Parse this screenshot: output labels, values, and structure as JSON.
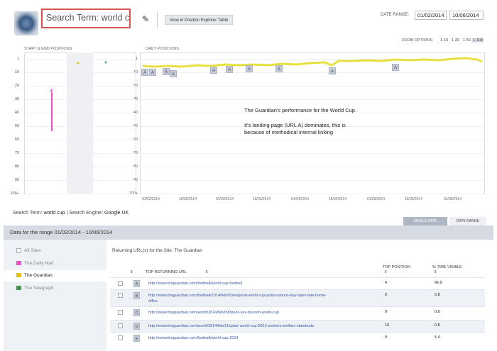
{
  "header": {
    "search_term": "Search Term: world cup",
    "view_button": "View in Position Explorer Table",
    "date_range_label": "DATE RANGE:",
    "date_start": "01/02/2014",
    "date_end": "10/06/2014",
    "edit_icon": "✎",
    "logo_icon": "logo-icon"
  },
  "zoom": {
    "label": "ZOOM OPTIONS:",
    "options": [
      "1-10",
      "1-20",
      "1-50",
      "1-100"
    ],
    "selected": "1-100"
  },
  "charts": {
    "start_end_title": "START & END POSITIONS",
    "daily_title": "DAILY POSITIONS",
    "y_ticks": [
      "1",
      "10",
      "20",
      "30",
      "40",
      "50",
      "60",
      "70",
      "80",
      "90",
      "100+"
    ],
    "x_ticks": [
      "01/02/2014",
      "15/02/2014",
      "01/03/2014",
      "15/03/2014",
      "01/04/2014",
      "15/04/2014",
      "01/05/2014",
      "15/05/2014",
      "01/06/2014"
    ],
    "start_marker": "▲",
    "end_marker": "▼",
    "annotation": {
      "line1": "The Guardian's performance for the World Cup.",
      "line2": "It's landing page (URL A) dominates, this is",
      "line3": "because of methodical internal linking"
    },
    "flags": [
      "A",
      "A",
      "A",
      "A",
      "A",
      "A",
      "A",
      "A",
      "A",
      "A"
    ],
    "colors": {
      "line": "#e8e040",
      "pink": "#ee4fcf",
      "start": "#e0c20d",
      "end": "#3d9a4a"
    }
  },
  "info": {
    "search_term_label": "Search Term:",
    "search_term_value": "world cup",
    "separator": "|",
    "engine_label": "Search Engine:",
    "engine_value": "Google UK",
    "single_date": "SINGLE DATE",
    "date_range": "DATE RANGE",
    "range_text": "Data for the range 01/02/2014 - 10/06/2014"
  },
  "sites": {
    "all": "All Sites",
    "items": [
      {
        "name": "The Daily Mail",
        "color": "#ee4fcf"
      },
      {
        "name": "The Guardian",
        "color": "#e0c20d"
      },
      {
        "name": "The Telegraph",
        "color": "#3d9a4a"
      }
    ]
  },
  "table": {
    "returning_label": "Returning URL(s) for the Site: The Guardian",
    "sort_icon": "⇕",
    "headers": {
      "url": "TOP RETURNING URL",
      "position": "TOP POSITION",
      "visible": "% TIME VISIBLE"
    },
    "rows": [
      {
        "letter": "A",
        "url": "http://www.theguardian.com/football/world-cup-football",
        "url2": "",
        "position": "4",
        "visible": "96.9"
      },
      {
        "letter": "B",
        "url": "http://www.theguardian.com/football/2014/feb/02/england-world-cup-pubs-cannot-stay-open-late-home-",
        "url2": "office",
        "position": "9",
        "visible": "0.8"
      },
      {
        "letter": "C",
        "url": "http://www.theguardian.com/world/2014/feb/09/brazil-sex-tourism-world-cup",
        "url2": "",
        "position": "9",
        "visible": "0.8"
      },
      {
        "letter": "D",
        "url": "http://www.theguardian.com/world/2014/feb/11/qatar-world-cup-2022-workers-welfare-standards",
        "url2": "",
        "position": "10",
        "visible": "0.8"
      },
      {
        "letter": "E",
        "url": "http://www.theguardian.com/football/world-cup-2014",
        "url2": "",
        "position": "9",
        "visible": "5.4"
      }
    ]
  }
}
